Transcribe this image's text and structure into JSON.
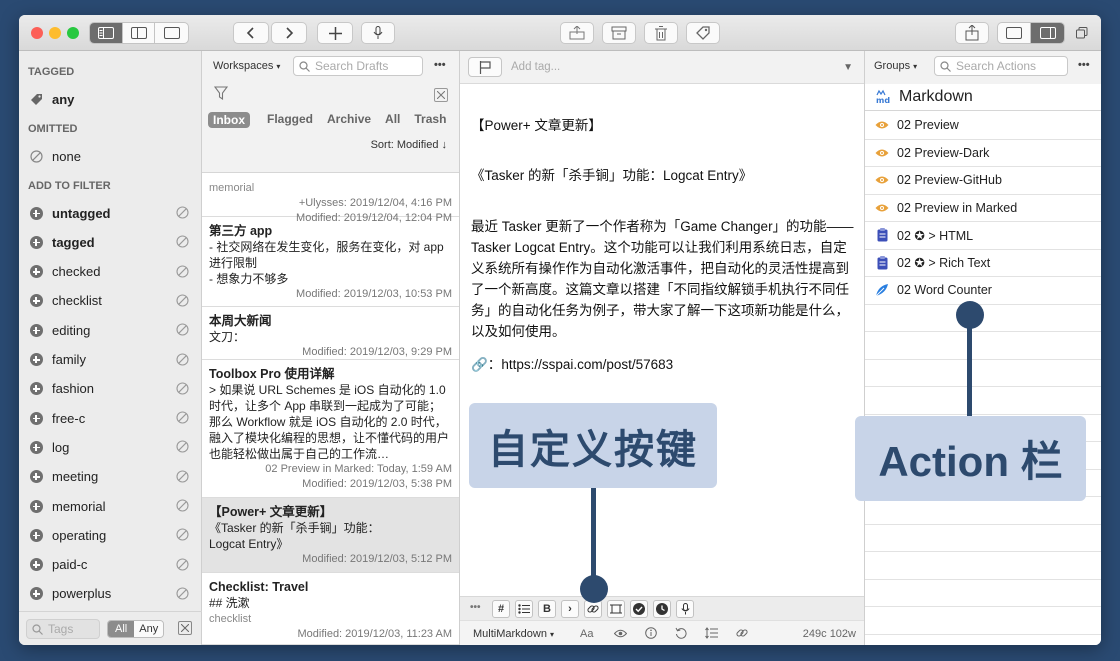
{
  "titlebar": {
    "buttons": [
      "sidebar-tags-icon",
      "sidebar-list-icon",
      "panel-icon",
      "back-icon",
      "forward-icon",
      "new-draft-icon",
      "mic-icon",
      "archive-up-icon",
      "archive-box-icon",
      "trash-icon",
      "tag-icon",
      "share-icon",
      "editor-icon",
      "actions-panel-icon",
      "window-icon"
    ]
  },
  "tag_sidebar": {
    "tagged_heading": "TAGGED",
    "any_label": "any",
    "omitted_heading": "OMITTED",
    "none_label": "none",
    "add_heading": "ADD TO FILTER",
    "filter_tags": [
      {
        "label": "untagged",
        "bold": true
      },
      {
        "label": "tagged",
        "bold": true
      },
      {
        "label": "checked",
        "bold": false
      },
      {
        "label": "checklist",
        "bold": false
      },
      {
        "label": "editing",
        "bold": false
      },
      {
        "label": "family",
        "bold": false
      },
      {
        "label": "fashion",
        "bold": false
      },
      {
        "label": "free-c",
        "bold": false
      },
      {
        "label": "log",
        "bold": false
      },
      {
        "label": "meeting",
        "bold": false
      },
      {
        "label": "memorial",
        "bold": false
      },
      {
        "label": "operating",
        "bold": false
      },
      {
        "label": "paid-c",
        "bold": false
      },
      {
        "label": "powerplus",
        "bold": false
      }
    ],
    "footer": {
      "search_placeholder": "Tags",
      "all_label": "All",
      "any_label": "Any"
    }
  },
  "draft_list": {
    "workspaces_label": "Workspaces",
    "search_placeholder": "Search Drafts",
    "more_label": "•••",
    "tabs": [
      "Inbox",
      "Flagged",
      "Archive",
      "All",
      "Trash"
    ],
    "active_tab": "Inbox",
    "sort_label": "Sort: Modified ↓",
    "items": [
      {
        "title": "",
        "body": "",
        "tag": "memorial",
        "meta1": "+Ulysses: 2019/12/04, 4:16 PM",
        "meta2": "Modified: 2019/12/04, 12:04 PM",
        "selected": false
      },
      {
        "title": "第三方 app",
        "body": "- 社交网络在发生变化，服务在变化，对 app 进行限制\n- 想象力不够多",
        "tag": "",
        "meta1": "",
        "meta2": "Modified: 2019/12/03, 10:53 PM",
        "selected": false
      },
      {
        "title": "本周大新闻",
        "body": "文刀：",
        "tag": "",
        "meta1": "",
        "meta2": "Modified: 2019/12/03, 9:29 PM",
        "selected": false
      },
      {
        "title": "Toolbox Pro 使用详解",
        "body": "> 如果说 URL Schemes 是 iOS 自动化的 1.0 时代，让多个 App 串联到一起成为了可能；那么 Workflow 就是 iOS 自动化的 2.0 时代，融入了模块化编程的思想，让不懂代码的用户也能轻松做出属于自己的工作流…",
        "tag": "",
        "meta1": "02 Preview in Marked: Today, 1:59 AM",
        "meta2": "Modified: 2019/12/03, 5:38 PM",
        "selected": false
      },
      {
        "title": "【Power+ 文章更新】",
        "body": "《Tasker 的新「杀手锏」功能：\nLogcat Entry》",
        "tag": "",
        "meta1": "",
        "meta2": "Modified: 2019/12/03, 5:12 PM",
        "selected": true
      },
      {
        "title": "Checklist: Travel",
        "body": "## 洗漱",
        "tag": "checklist",
        "meta1": "",
        "meta2": "Modified: 2019/12/03, 11:23 AM",
        "selected": false
      }
    ]
  },
  "editor": {
    "tag_placeholder": "Add tag...",
    "line1": "【Power+ 文章更新】",
    "line2": "《Tasker 的新「杀手锏」功能：Logcat Entry》",
    "para": "最近 Tasker 更新了一个作者称为「Game Changer」的功能——Tasker Logcat Entry。这个功能可以让我们利用系统日志，自定义系统所有操作作为自动化激活事件，把自动化的灵活性提高到了一个新高度。这篇文章以搭建「不同指纹解锁手机执行不同任务」的自动化任务为例子，带大家了解一下这项新功能是什么，以及如何使用。",
    "link_prefix": "🔗：",
    "link": "https://sspai.com/post/57683",
    "keys": [
      "•••",
      "#",
      "list-icon",
      "B",
      "›",
      "link-icon",
      "frame-icon",
      "check-icon",
      "clock-icon",
      "mic-icon"
    ],
    "syntax": "MultiMarkdown",
    "font_label": "Aa",
    "counts": "249c 102w"
  },
  "actions": {
    "groups_label": "Groups",
    "search_placeholder": "Search Actions",
    "more_label": "•••",
    "group_title": "Markdown",
    "items": [
      {
        "label": "02 Preview",
        "icon": "eye-icon"
      },
      {
        "label": "02 Preview-Dark",
        "icon": "eye-icon"
      },
      {
        "label": "02 Preview-GitHub",
        "icon": "eye-icon"
      },
      {
        "label": "02 Preview in Marked",
        "icon": "eye-icon"
      },
      {
        "label": "02 ✪ > HTML",
        "icon": "clipboard-icon"
      },
      {
        "label": "02 ✪ > Rich Text",
        "icon": "clipboard-icon"
      },
      {
        "label": "02 Word Counter",
        "icon": "feather-icon"
      }
    ]
  },
  "callouts": {
    "keys_label": "自定义按键",
    "actions_label": "Action 栏"
  },
  "colors": {
    "background": "#2a4a72",
    "callout_bg": "#c8d4e8",
    "callout_fg": "#2d4a6e",
    "eye_icon": "#e8a13a",
    "clipboard_icon": "#3c4fb8",
    "feather_icon": "#2a7fe0"
  }
}
